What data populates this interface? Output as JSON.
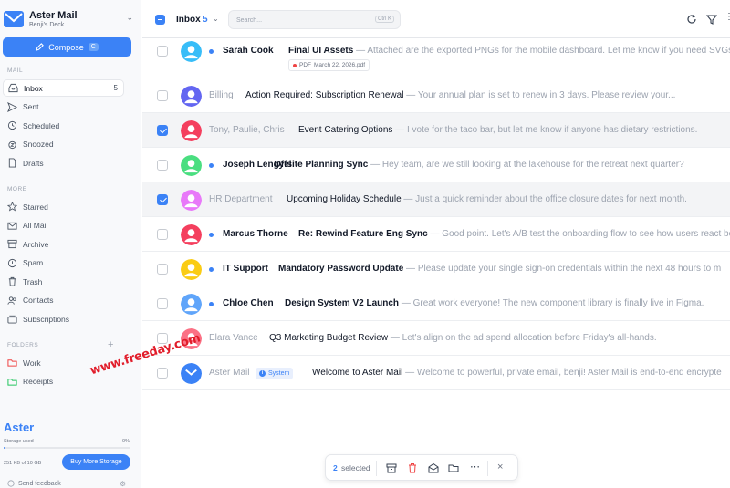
{
  "brand": {
    "name": "Aster Mail",
    "subtitle": "Benji's Deck",
    "color": "#3b82f6"
  },
  "compose": {
    "label": "Compose",
    "shortcut": "C"
  },
  "sections": {
    "mail": "MAIL",
    "more": "MORE",
    "folders": "FOLDERS"
  },
  "nav_mail": [
    {
      "label": "Inbox",
      "icon": "inbox-icon",
      "count": "5",
      "active": true
    },
    {
      "label": "Sent",
      "icon": "send-icon"
    },
    {
      "label": "Scheduled",
      "icon": "clock-icon"
    },
    {
      "label": "Snoozed",
      "icon": "snooze-icon"
    },
    {
      "label": "Drafts",
      "icon": "draft-icon"
    }
  ],
  "nav_more": [
    {
      "label": "Starred",
      "icon": "star-icon"
    },
    {
      "label": "All Mail",
      "icon": "mail-icon"
    },
    {
      "label": "Archive",
      "icon": "archive-icon"
    },
    {
      "label": "Spam",
      "icon": "spam-icon"
    },
    {
      "label": "Trash",
      "icon": "trash-icon"
    },
    {
      "label": "Contacts",
      "icon": "contacts-icon"
    },
    {
      "label": "Subscriptions",
      "icon": "subscriptions-icon"
    }
  ],
  "folders": [
    {
      "label": "Work",
      "color": "#ef4444"
    },
    {
      "label": "Receipts",
      "color": "#22c55e"
    }
  ],
  "footer": {
    "logo": "Aster",
    "storage_label": "Storage used",
    "storage_pct": "0%",
    "storage_fraction": 0.0,
    "storage_size": "251 KB of 10 GB",
    "buy_label": "Buy More Storage",
    "feedback_label": "Send feedback"
  },
  "header": {
    "title": "Inbox",
    "count": "5",
    "search_placeholder": "Search...",
    "search_shortcut": "Ctrl K"
  },
  "emails": [
    {
      "sender": "Sarah Cook",
      "unread": true,
      "checked": false,
      "avatar_color": "#38bdf8",
      "subject": "Final UI Assets",
      "preview": " — Attached are the exported PNGs for the mobile dashboard. Let me know if you need SVGs",
      "attachment": {
        "type": "PDF",
        "name": "March 22, 2026.pdf"
      }
    },
    {
      "sender": "Billing",
      "unread": false,
      "checked": false,
      "avatar_color": "#6366f1",
      "subject": "Action Required: Subscription Renewal",
      "preview": " — Your annual plan is set to renew in 3 days. Please review your..."
    },
    {
      "sender": "Tony, Paulie, Chris",
      "unread": false,
      "checked": true,
      "avatar_color": "#f43f5e",
      "subject": "Event Catering Options",
      "preview": " — I vote for the taco bar, but let me know if anyone has dietary restrictions."
    },
    {
      "sender": "Joseph Lengyel",
      "unread": true,
      "checked": false,
      "avatar_color": "#4ade80",
      "subject": "Offsite Planning Sync",
      "preview": " — Hey team, are we still looking at the lakehouse for the retreat next quarter?"
    },
    {
      "sender": "HR Department",
      "unread": false,
      "checked": true,
      "avatar_color": "#e879f9",
      "subject": "Upcoming Holiday Schedule",
      "preview": " — Just a quick reminder about the office closure dates for next month."
    },
    {
      "sender": "Marcus Thorne",
      "unread": true,
      "checked": false,
      "avatar_color": "#f43f5e",
      "subject": "Re: Rewind Feature Eng Sync",
      "preview": " — Good point. Let's A/B test the onboarding flow to see how users react be"
    },
    {
      "sender": "IT Support",
      "unread": true,
      "checked": false,
      "avatar_color": "#facc15",
      "subject": "Mandatory Password Update",
      "preview": " — Please update your single sign-on credentials within the next 48 hours to m"
    },
    {
      "sender": "Chloe Chen",
      "unread": true,
      "checked": false,
      "avatar_color": "#60a5fa",
      "subject": "Design System V2 Launch",
      "preview": " — Great work everyone! The new component library is finally live in Figma."
    },
    {
      "sender": "Elara Vance",
      "unread": false,
      "checked": false,
      "avatar_color": "#fb7185",
      "subject": "Q3 Marketing Budget Review",
      "preview": " — Let's align on the ad spend allocation before Friday's all-hands."
    },
    {
      "sender": "Aster Mail",
      "unread": false,
      "checked": false,
      "avatar_color": "#3b82f6",
      "badge": "System",
      "subject": "Welcome to Aster Mail",
      "preview": " — Welcome to powerful, private email, benji! Aster Mail is end-to-end encrypte"
    }
  ],
  "watermark": "www.freeday.com",
  "selection_bar": {
    "count": "2",
    "label": "selected"
  }
}
